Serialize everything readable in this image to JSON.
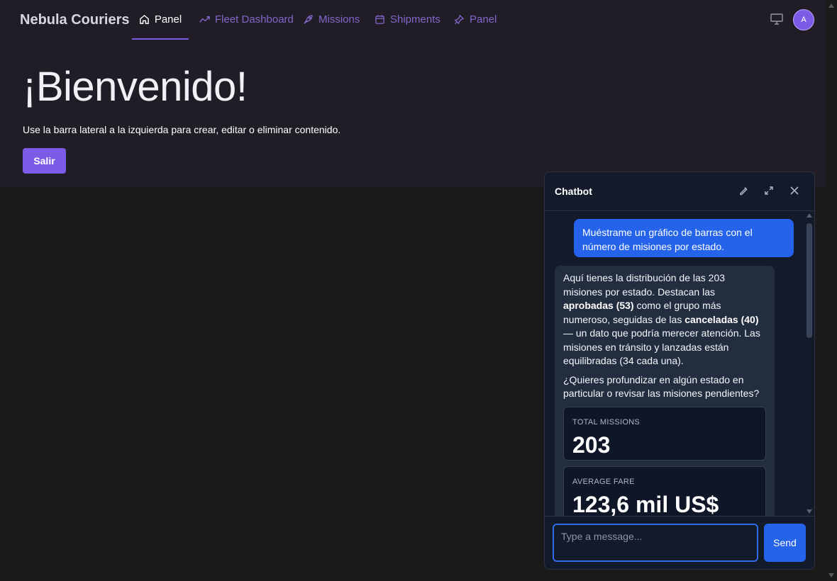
{
  "nav": {
    "brand": "Nebula Couriers",
    "items": [
      {
        "label": "Panel",
        "icon": "home-icon",
        "active": true
      },
      {
        "label": "Fleet Dashboard",
        "icon": "trend-icon",
        "active": false
      },
      {
        "label": "Missions",
        "icon": "rocket-icon",
        "active": false
      },
      {
        "label": "Shipments",
        "icon": "calendar-icon",
        "active": false
      },
      {
        "label": "Panel",
        "icon": "pin-icon",
        "active": false
      }
    ],
    "avatar_initial": "A"
  },
  "main": {
    "title": "¡Bienvenido!",
    "subtitle": "Use la barra lateral a la izquierda para crear, editar o eliminar contenido.",
    "exit_label": "Salir"
  },
  "chat": {
    "title": "Chatbot",
    "user_message": "Muéstrame un gráfico de barras con el número de misiones por estado.",
    "bot_p1_a": "Aquí tienes la distribución de las 203 misiones por estado. Destacan las ",
    "bot_p1_b": "aprobadas (53)",
    "bot_p1_c": " como el grupo más numeroso, seguidas de las ",
    "bot_p1_d": "canceladas (40)",
    "bot_p1_e": " — un dato que podría merecer atención. Las misiones en tránsito y lanzadas están equilibradas (34 cada una).",
    "bot_p2": "¿Quieres profundizar en algún estado en particular o revisar las misiones pendientes?",
    "kpis": [
      {
        "label": "TOTAL MISSIONS",
        "value": "203"
      },
      {
        "label": "AVERAGE FARE",
        "value": "123,6 mil US$"
      }
    ],
    "input_placeholder": "Type a message...",
    "input_value": "",
    "send_label": "Send"
  },
  "colors": {
    "accent": "#7c5ce6",
    "chat_accent": "#2563eb",
    "header_bg": "#211d27",
    "page_bg": "#1a1a1a"
  }
}
